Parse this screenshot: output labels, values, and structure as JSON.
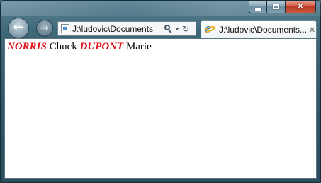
{
  "browser": {
    "address": {
      "url_text": "J:\\ludovic\\Documents"
    },
    "tab": {
      "title": "J:\\ludovic\\Documents..."
    },
    "icons": {
      "back": "back-arrow-icon",
      "forward": "forward-arrow-icon",
      "page": "page-icon",
      "search": "search-icon",
      "dropdown": "chevron-down-icon",
      "refresh": "refresh-icon",
      "favicon": "internet-explorer-icon",
      "close_tab": "close-icon"
    }
  },
  "window_controls": {
    "minimize": "minimize-icon",
    "maximize": "maximize-icon",
    "close": "close-icon"
  },
  "content": {
    "people": [
      {
        "last_name": "NORRIS",
        "first_name": "Chuck"
      },
      {
        "last_name": "DUPONT",
        "first_name": "Marie"
      }
    ]
  },
  "colors": {
    "last_name": "#e0101a"
  }
}
